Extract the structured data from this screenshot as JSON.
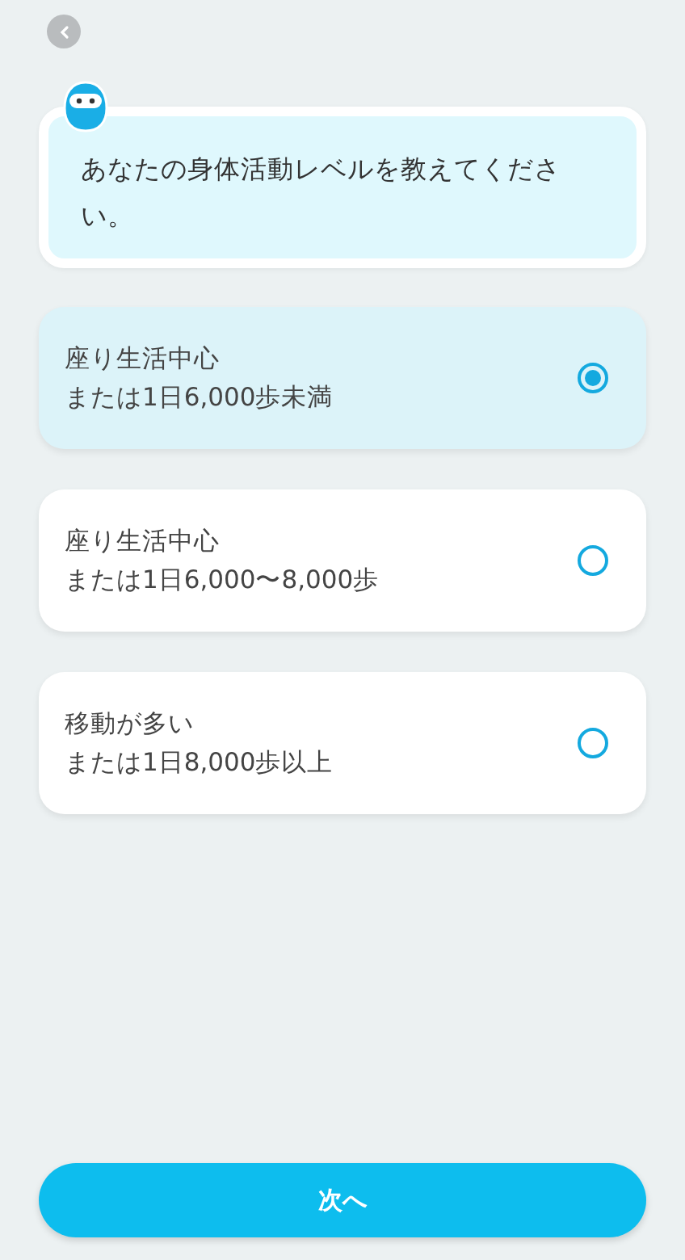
{
  "question": "あなたの身体活動レベルを教えてください。",
  "options": [
    {
      "title": "座り生活中心",
      "detail": "または1日6,000歩未満",
      "selected": true
    },
    {
      "title": "座り生活中心",
      "detail": "または1日6,000〜8,000歩",
      "selected": false
    },
    {
      "title": "移動が多い",
      "detail": "または1日8,000歩以上",
      "selected": false
    }
  ],
  "next_button": "次へ"
}
